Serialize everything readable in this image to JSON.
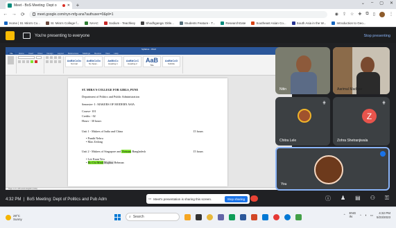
{
  "browser": {
    "tab_title": "Meet - BoS Meeting: Dept o",
    "url": "meet.google.com/nyn-mfg-ana?authuser=0&pli=1",
    "bookmarks": [
      {
        "label": "Home | St. Mira's Co...",
        "color": "#1565c0"
      },
      {
        "label": "St. Mira's College f...",
        "color": "#6d4c41"
      },
      {
        "label": "NAAC",
        "color": "#2e7d32"
      },
      {
        "label": "Sodium - Teachkey",
        "color": "#c62828"
      },
      {
        "label": "Shodhganga: Ditle...",
        "color": "#424242"
      },
      {
        "label": "Students Feature - T...",
        "color": "#546e7a"
      },
      {
        "label": "ResearchGate",
        "color": "#00897b"
      },
      {
        "label": "Southeast Asian Co...",
        "color": "#d84315"
      },
      {
        "label": "South Asia in the W...",
        "color": "#283593"
      },
      {
        "label": "Introduction to Geo...",
        "color": "#1565c0"
      }
    ],
    "other_bookmarks": "Other bookmarks"
  },
  "meet": {
    "presenting_text": "You're presenting to everyone",
    "stop_presenting": "Stop presenting",
    "meeting_time": "4:32 PM",
    "meeting_title": "BoS Meeting: Dept of Politics and Pub Adm",
    "toast_text": "Meet's presentation is sharing this screen.",
    "toast_button": "Stop sharing",
    "participants": [
      {
        "name": "Nitin"
      },
      {
        "name": "Aarimal Madhav"
      },
      {
        "name": "Chitra Lele"
      },
      {
        "name": "Zohra Shetranjiwala",
        "initial": "Z"
      },
      {
        "name": "You"
      }
    ]
  },
  "word": {
    "window_title": "Syllabus - Word",
    "menu": [
      "File",
      "Home",
      "Insert",
      "Draw",
      "Design",
      "Layout",
      "References",
      "Mailings",
      "Review",
      "View",
      "Help"
    ],
    "style_samples": [
      {
        "big": "AaBbCcDc",
        "label": "Normal"
      },
      {
        "big": "AaBbCcDc",
        "label": "No Spac..."
      },
      {
        "big": "AaBbCc",
        "label": "Heading 1"
      },
      {
        "big": "AaBbCcC",
        "label": "Heading 2"
      },
      {
        "big": "AaB",
        "label": "Title"
      },
      {
        "big": "AaBbCcD",
        "label": "Subtitle"
      }
    ],
    "status": "Page 1 of 1    145 words    English (India)",
    "doc": {
      "college": "ST. MIRA'S COLLEGE FOR GIRLS, PUNE",
      "dept": "Department of Politics and Public Administration",
      "semester": "Semester- I : MAKERS OF MODERN ASIA",
      "course": "Course- 101",
      "credits": "Credits - 02",
      "hours": "Hours - 30 hours",
      "unit1": "Unit 1 - Makers of India and China",
      "unit1_hours": "15 hours",
      "unit1_items": [
        "Pandit Nehru",
        "Mao Zedong"
      ],
      "unit2_pre": "Unit 2 - Makers of Singapore and ",
      "unit2_hl": "Vietnam",
      "unit2_post": " Bangladesh",
      "unit2_hours": "15 hours",
      "unit2_item1": "Lee Kuan Yew",
      "unit2_item2_hl": "Ho Chi Minh",
      "unit2_item2_mid": " Mujibur",
      "unit2_item2_post": " Rehman"
    }
  },
  "taskbar": {
    "weather_temp": "29°C",
    "weather_desc": "Sunny",
    "search_placeholder": "Search",
    "lang": "ENG\nIN",
    "time": "4:32 PM",
    "date": "5/23/2023"
  }
}
